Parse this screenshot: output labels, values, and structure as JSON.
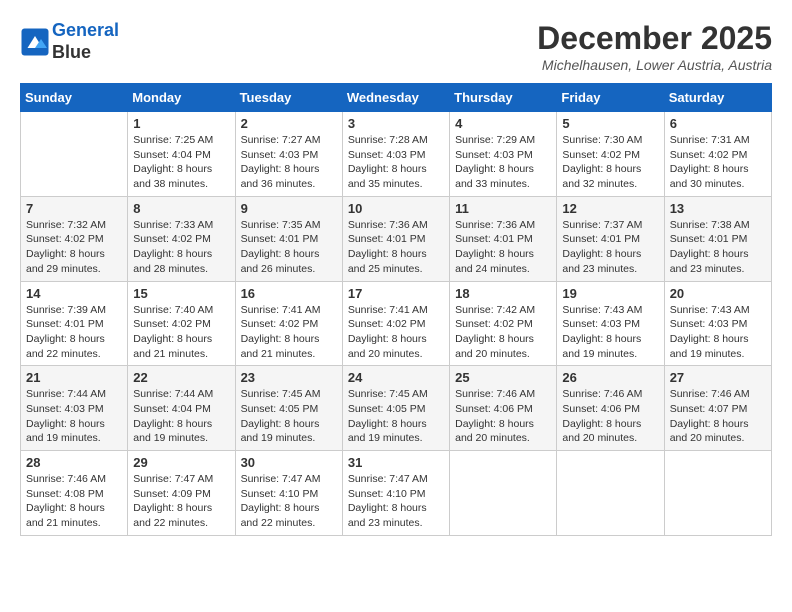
{
  "header": {
    "logo_line1": "General",
    "logo_line2": "Blue",
    "month_title": "December 2025",
    "location": "Michelhausen, Lower Austria, Austria"
  },
  "days_of_week": [
    "Sunday",
    "Monday",
    "Tuesday",
    "Wednesday",
    "Thursday",
    "Friday",
    "Saturday"
  ],
  "weeks": [
    [
      {
        "day": "",
        "sunrise": "",
        "sunset": "",
        "daylight": ""
      },
      {
        "day": "1",
        "sunrise": "Sunrise: 7:25 AM",
        "sunset": "Sunset: 4:04 PM",
        "daylight": "Daylight: 8 hours and 38 minutes."
      },
      {
        "day": "2",
        "sunrise": "Sunrise: 7:27 AM",
        "sunset": "Sunset: 4:03 PM",
        "daylight": "Daylight: 8 hours and 36 minutes."
      },
      {
        "day": "3",
        "sunrise": "Sunrise: 7:28 AM",
        "sunset": "Sunset: 4:03 PM",
        "daylight": "Daylight: 8 hours and 35 minutes."
      },
      {
        "day": "4",
        "sunrise": "Sunrise: 7:29 AM",
        "sunset": "Sunset: 4:03 PM",
        "daylight": "Daylight: 8 hours and 33 minutes."
      },
      {
        "day": "5",
        "sunrise": "Sunrise: 7:30 AM",
        "sunset": "Sunset: 4:02 PM",
        "daylight": "Daylight: 8 hours and 32 minutes."
      },
      {
        "day": "6",
        "sunrise": "Sunrise: 7:31 AM",
        "sunset": "Sunset: 4:02 PM",
        "daylight": "Daylight: 8 hours and 30 minutes."
      }
    ],
    [
      {
        "day": "7",
        "sunrise": "Sunrise: 7:32 AM",
        "sunset": "Sunset: 4:02 PM",
        "daylight": "Daylight: 8 hours and 29 minutes."
      },
      {
        "day": "8",
        "sunrise": "Sunrise: 7:33 AM",
        "sunset": "Sunset: 4:02 PM",
        "daylight": "Daylight: 8 hours and 28 minutes."
      },
      {
        "day": "9",
        "sunrise": "Sunrise: 7:35 AM",
        "sunset": "Sunset: 4:01 PM",
        "daylight": "Daylight: 8 hours and 26 minutes."
      },
      {
        "day": "10",
        "sunrise": "Sunrise: 7:36 AM",
        "sunset": "Sunset: 4:01 PM",
        "daylight": "Daylight: 8 hours and 25 minutes."
      },
      {
        "day": "11",
        "sunrise": "Sunrise: 7:36 AM",
        "sunset": "Sunset: 4:01 PM",
        "daylight": "Daylight: 8 hours and 24 minutes."
      },
      {
        "day": "12",
        "sunrise": "Sunrise: 7:37 AM",
        "sunset": "Sunset: 4:01 PM",
        "daylight": "Daylight: 8 hours and 23 minutes."
      },
      {
        "day": "13",
        "sunrise": "Sunrise: 7:38 AM",
        "sunset": "Sunset: 4:01 PM",
        "daylight": "Daylight: 8 hours and 23 minutes."
      }
    ],
    [
      {
        "day": "14",
        "sunrise": "Sunrise: 7:39 AM",
        "sunset": "Sunset: 4:01 PM",
        "daylight": "Daylight: 8 hours and 22 minutes."
      },
      {
        "day": "15",
        "sunrise": "Sunrise: 7:40 AM",
        "sunset": "Sunset: 4:02 PM",
        "daylight": "Daylight: 8 hours and 21 minutes."
      },
      {
        "day": "16",
        "sunrise": "Sunrise: 7:41 AM",
        "sunset": "Sunset: 4:02 PM",
        "daylight": "Daylight: 8 hours and 21 minutes."
      },
      {
        "day": "17",
        "sunrise": "Sunrise: 7:41 AM",
        "sunset": "Sunset: 4:02 PM",
        "daylight": "Daylight: 8 hours and 20 minutes."
      },
      {
        "day": "18",
        "sunrise": "Sunrise: 7:42 AM",
        "sunset": "Sunset: 4:02 PM",
        "daylight": "Daylight: 8 hours and 20 minutes."
      },
      {
        "day": "19",
        "sunrise": "Sunrise: 7:43 AM",
        "sunset": "Sunset: 4:03 PM",
        "daylight": "Daylight: 8 hours and 19 minutes."
      },
      {
        "day": "20",
        "sunrise": "Sunrise: 7:43 AM",
        "sunset": "Sunset: 4:03 PM",
        "daylight": "Daylight: 8 hours and 19 minutes."
      }
    ],
    [
      {
        "day": "21",
        "sunrise": "Sunrise: 7:44 AM",
        "sunset": "Sunset: 4:03 PM",
        "daylight": "Daylight: 8 hours and 19 minutes."
      },
      {
        "day": "22",
        "sunrise": "Sunrise: 7:44 AM",
        "sunset": "Sunset: 4:04 PM",
        "daylight": "Daylight: 8 hours and 19 minutes."
      },
      {
        "day": "23",
        "sunrise": "Sunrise: 7:45 AM",
        "sunset": "Sunset: 4:05 PM",
        "daylight": "Daylight: 8 hours and 19 minutes."
      },
      {
        "day": "24",
        "sunrise": "Sunrise: 7:45 AM",
        "sunset": "Sunset: 4:05 PM",
        "daylight": "Daylight: 8 hours and 19 minutes."
      },
      {
        "day": "25",
        "sunrise": "Sunrise: 7:46 AM",
        "sunset": "Sunset: 4:06 PM",
        "daylight": "Daylight: 8 hours and 20 minutes."
      },
      {
        "day": "26",
        "sunrise": "Sunrise: 7:46 AM",
        "sunset": "Sunset: 4:06 PM",
        "daylight": "Daylight: 8 hours and 20 minutes."
      },
      {
        "day": "27",
        "sunrise": "Sunrise: 7:46 AM",
        "sunset": "Sunset: 4:07 PM",
        "daylight": "Daylight: 8 hours and 20 minutes."
      }
    ],
    [
      {
        "day": "28",
        "sunrise": "Sunrise: 7:46 AM",
        "sunset": "Sunset: 4:08 PM",
        "daylight": "Daylight: 8 hours and 21 minutes."
      },
      {
        "day": "29",
        "sunrise": "Sunrise: 7:47 AM",
        "sunset": "Sunset: 4:09 PM",
        "daylight": "Daylight: 8 hours and 22 minutes."
      },
      {
        "day": "30",
        "sunrise": "Sunrise: 7:47 AM",
        "sunset": "Sunset: 4:10 PM",
        "daylight": "Daylight: 8 hours and 22 minutes."
      },
      {
        "day": "31",
        "sunrise": "Sunrise: 7:47 AM",
        "sunset": "Sunset: 4:10 PM",
        "daylight": "Daylight: 8 hours and 23 minutes."
      },
      {
        "day": "",
        "sunrise": "",
        "sunset": "",
        "daylight": ""
      },
      {
        "day": "",
        "sunrise": "",
        "sunset": "",
        "daylight": ""
      },
      {
        "day": "",
        "sunrise": "",
        "sunset": "",
        "daylight": ""
      }
    ]
  ]
}
